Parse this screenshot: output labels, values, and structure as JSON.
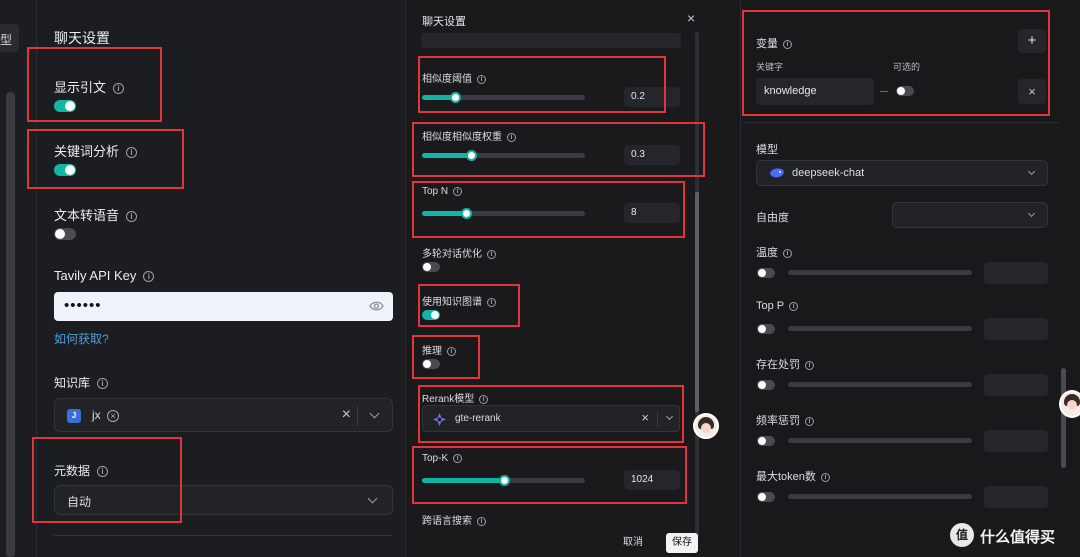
{
  "panel1": {
    "partial_tab": "型",
    "title": "聊天设置",
    "show_quote": {
      "label": "显示引文",
      "on": true
    },
    "keyword_analysis": {
      "label": "关键词分析",
      "on": true
    },
    "tts": {
      "label": "文本转语音",
      "on": false
    },
    "tavily": {
      "label": "Tavily API Key",
      "value": "••••••"
    },
    "how_to_get": "如何获取?",
    "kb": {
      "label": "知识库",
      "tag_letter": "J",
      "tag_text": "jx",
      "clear_icon": "close-icon"
    },
    "metadata": {
      "label": "元数据",
      "value": "自动"
    }
  },
  "panel2": {
    "title": "聊天设置",
    "similarity": {
      "label": "相似度阈值",
      "value": "0.2",
      "level": 0.2
    },
    "sim_weight": {
      "label": "相似度相似度权重",
      "value": "0.3",
      "level": 0.3
    },
    "topn": {
      "label": "Top N",
      "value": "8",
      "level": 0.27
    },
    "multi_turn": {
      "label": "多轮对话优化",
      "on": false
    },
    "kg": {
      "label": "使用知识图谱",
      "on": true
    },
    "reasoning": {
      "label": "推理",
      "on": false
    },
    "rerank": {
      "label": "Rerank模型",
      "value": "gte-rerank"
    },
    "topk": {
      "label": "Top-K",
      "value": "1024",
      "level": 0.5
    },
    "cross_lang": "跨语言搜索",
    "cancel": "取消",
    "save": "保存"
  },
  "panel3": {
    "variables": {
      "label": "变量",
      "keyword_header": "关键字",
      "optional_header": "可选的",
      "keyword_value": "knowledge",
      "optional_on": false
    },
    "model": {
      "label": "模型",
      "value": "deepseek-chat"
    },
    "freedom": {
      "label": "自由度",
      "value": ""
    },
    "temperature": {
      "label": "温度",
      "on": false
    },
    "top_p": {
      "label": "Top P",
      "on": false
    },
    "presence": {
      "label": "存在处罚",
      "on": false
    },
    "frequency": {
      "label": "频率惩罚",
      "on": false
    },
    "max_tokens": {
      "label": "最大token数",
      "on": false
    }
  },
  "watermark": {
    "badge": "值",
    "text": "什么值得买"
  },
  "colors": {
    "accent": "#12b5a5",
    "highlight": "#e0353d",
    "background": "#1a1b1e"
  }
}
